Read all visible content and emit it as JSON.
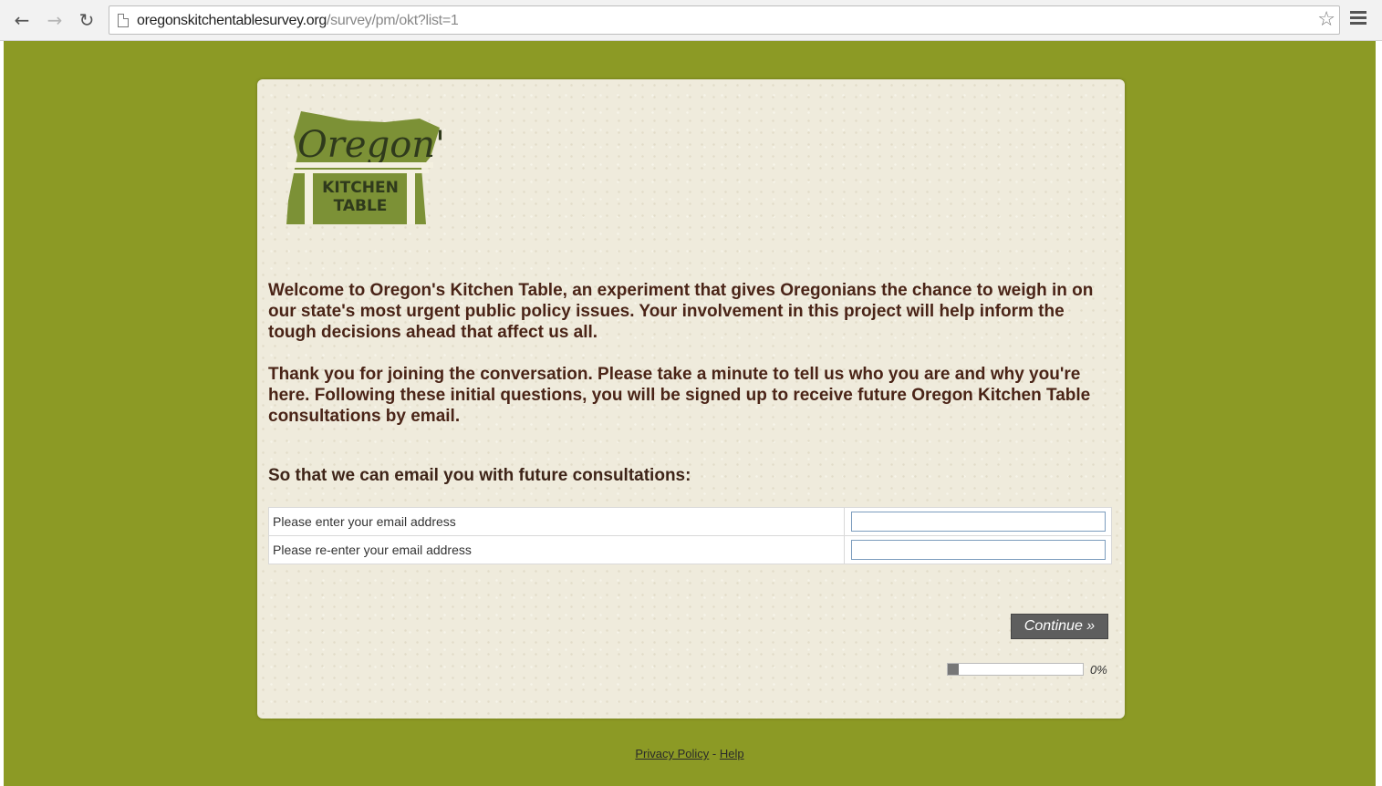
{
  "browser": {
    "url_host": "oregonskitchentablesurvey.org",
    "url_path": "/survey/pm/okt?list=1"
  },
  "logo": {
    "line1": "Oregon's",
    "line2": "KITCHEN",
    "line3": "TABLE",
    "color": "#7c9136"
  },
  "intro": {
    "paragraph1": "Welcome to Oregon's Kitchen Table, an experiment that gives Oregonians the chance to weigh in on our state's most urgent public policy issues. Your involvement in this project will help inform the tough decisions ahead that affect us all.",
    "paragraph2": "Thank you for joining the conversation. Please take a minute to tell us who you are and why you're here. Following these initial questions, you will be signed up to receive future Oregon Kitchen Table consultations by email."
  },
  "form": {
    "heading": "So that we can email you with future consultations:",
    "email_label": "Please enter your email address",
    "email_value": "",
    "reenter_label": "Please re-enter your email address",
    "reenter_value": ""
  },
  "continue_label": "Continue »",
  "progress": {
    "value": 0,
    "label": "0%"
  },
  "footer": {
    "privacy": "Privacy Policy",
    "separator": " - ",
    "help": "Help"
  },
  "colors": {
    "page_background": "#8c9a25",
    "text_brown": "#4a2417",
    "button": "#5e5e5e"
  }
}
